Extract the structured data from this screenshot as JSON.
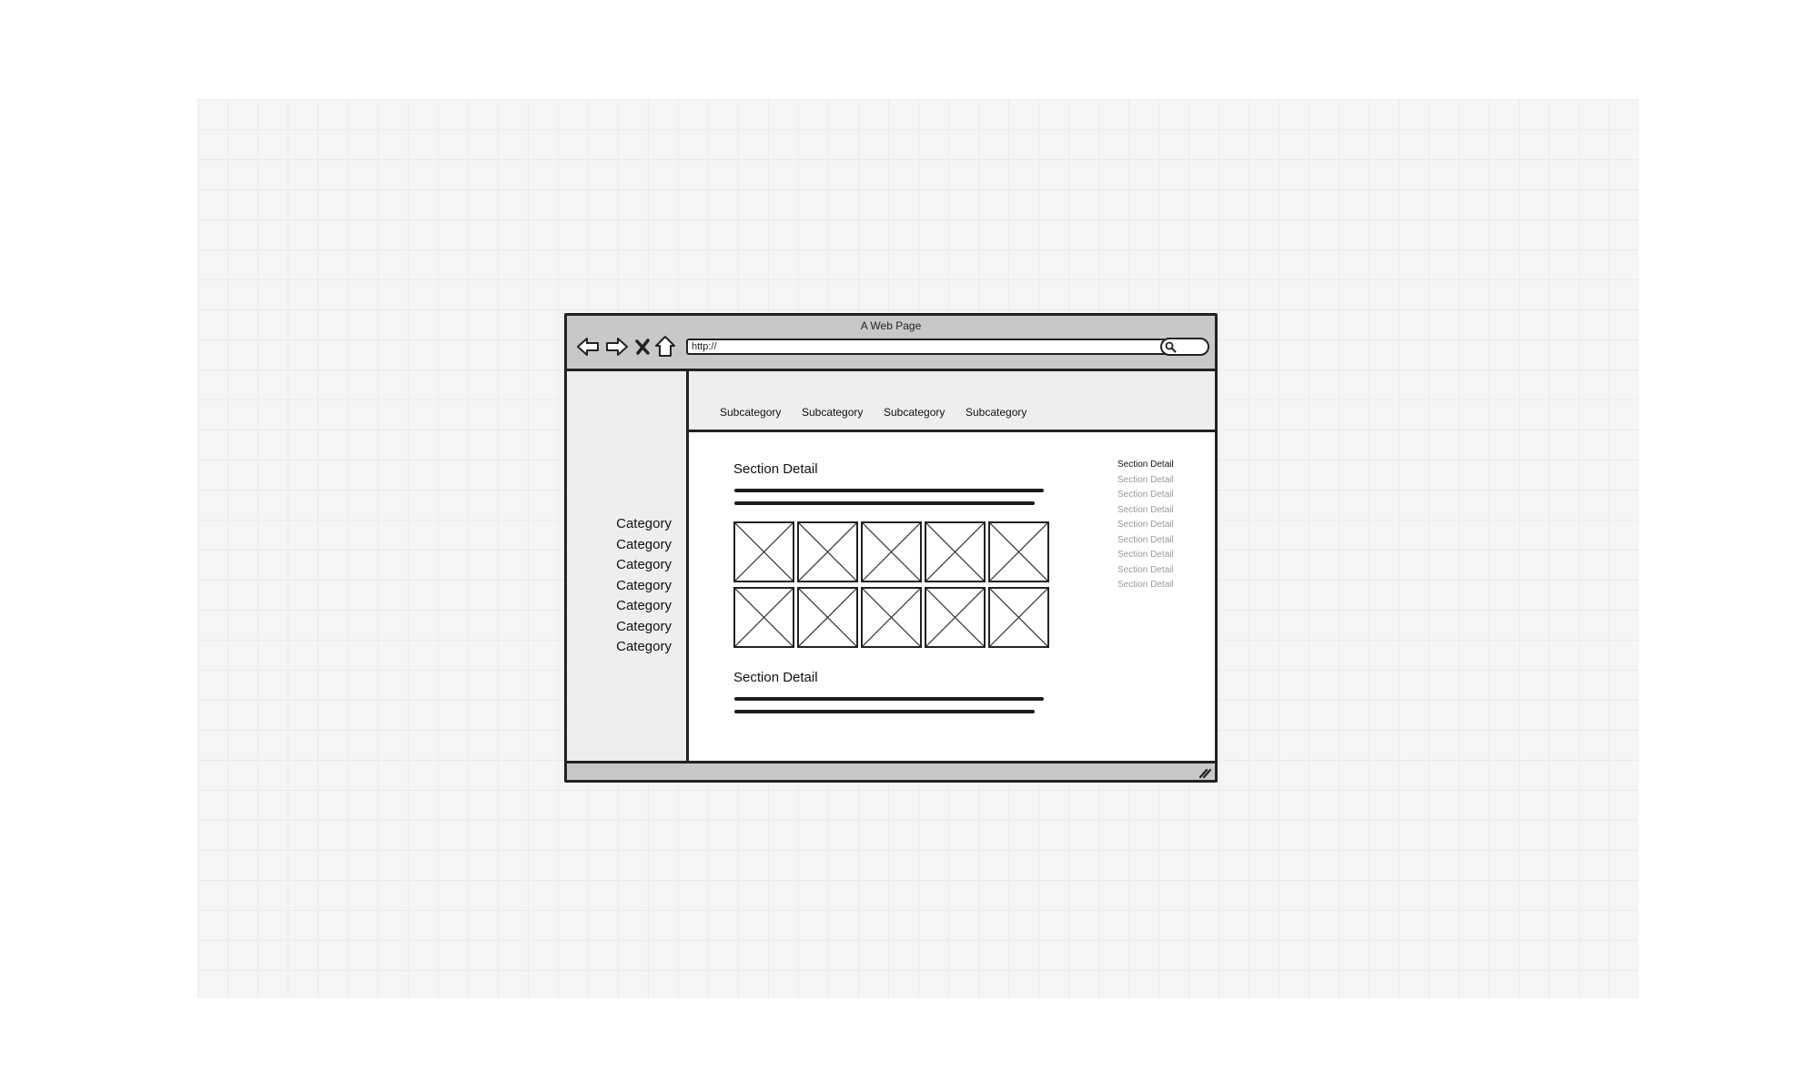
{
  "window": {
    "title": "A Web Page",
    "url": "http://"
  },
  "toolbar": {
    "icons": [
      "back-arrow-icon",
      "forward-arrow-icon",
      "close-x-icon",
      "home-icon",
      "search-icon"
    ]
  },
  "sidebar": {
    "categories": [
      "Category",
      "Category",
      "Category",
      "Category",
      "Category",
      "Category",
      "Category"
    ]
  },
  "subnav": {
    "items": [
      "Subcategory",
      "Subcategory",
      "Subcategory",
      "Subcategory"
    ]
  },
  "main": {
    "sections": [
      {
        "title": "Section Detail"
      },
      {
        "title": "Section Detail"
      }
    ],
    "image_grid": {
      "rows": 2,
      "columns": 5
    }
  },
  "toc": {
    "items": [
      "Section Detail",
      "Section Detail",
      "Section Detail",
      "Section Detail",
      "Section Detail",
      "Section Detail",
      "Section Detail",
      "Section Detail",
      "Section Detail"
    ],
    "active_index": 0
  },
  "colors": {
    "chrome": "#c8c8c8",
    "panel": "#eeeeee",
    "border": "#222222",
    "muted_text": "#999999"
  }
}
